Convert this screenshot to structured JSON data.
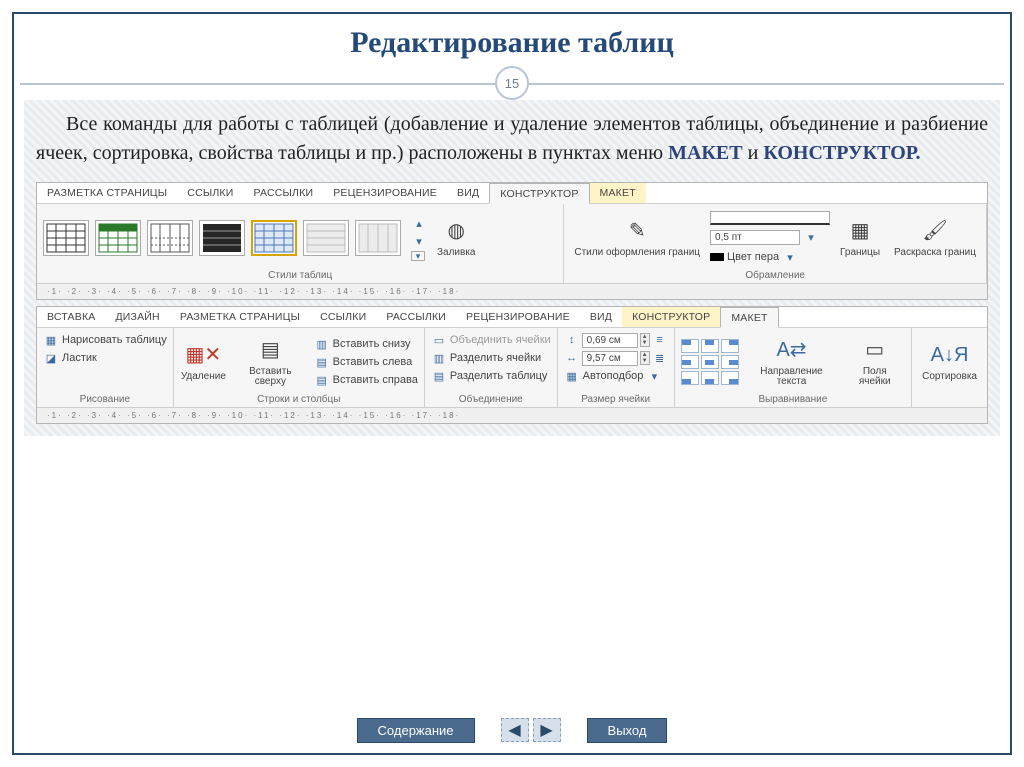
{
  "title": "Редактирование таблиц",
  "page_number": "15",
  "paragraph_pre": "Все команды для работы с таблицей (добавление и удаление элементов таблицы, объединение и разбиение ячеек,  сортировка,  свойства таблицы и пр.) расположены в пунктах меню ",
  "paragraph_b1": "МАКЕТ",
  "paragraph_mid": " и ",
  "paragraph_b2": "КОНСТРУКТОР.",
  "ribbon1": {
    "tabs": [
      "РАЗМЕТКА СТРАНИЦЫ",
      "ССЫЛКИ",
      "РАССЫЛКИ",
      "РЕЦЕНЗИРОВАНИЕ",
      "ВИД",
      "КОНСТРУКТОР",
      "МАКЕТ"
    ],
    "active_tab_index": 5,
    "group_styles_label": "Стили таблиц",
    "fill_label": "Заливка",
    "border_styles_label": "Стили оформления границ",
    "width_value": "0,5 пт",
    "pen_color_label": "Цвет пера",
    "group_border_label": "Обрамление",
    "borders_btn": "Границы",
    "paint_borders_btn": "Раскраска границ",
    "ruler_marks": "·1· ·2· ·3· ·4· ·5· ·6· ·7· ·8· ·9· ·10· ·11· ·12· ·13· ·14· ·15· ·16· ·17· ·18·"
  },
  "ribbon2": {
    "tabs": [
      "ВСТАВКА",
      "ДИЗАЙН",
      "РАЗМЕТКА СТРАНИЦЫ",
      "ССЫЛКИ",
      "РАССЫЛКИ",
      "РЕЦЕНЗИРОВАНИЕ",
      "ВИД",
      "КОНСТРУКТОР",
      "МАКЕТ"
    ],
    "active_tab_index": 8,
    "draw_table": "Нарисовать таблицу",
    "eraser": "Ластик",
    "group_draw": "Рисование",
    "delete": "Удаление",
    "insert_above": "Вставить сверху",
    "insert_below": "Вставить снизу",
    "insert_left": "Вставить слева",
    "insert_right": "Вставить справа",
    "group_rowscols": "Строки и столбцы",
    "merge": "Объединить ячейки",
    "split_cells": "Разделить ячейки",
    "split_table": "Разделить таблицу",
    "group_merge": "Объединение",
    "height_value": "0,69 см",
    "width_value": "9,57 см",
    "autofit": "Автоподбор",
    "group_size": "Размер ячейки",
    "text_dir": "Направление текста",
    "cell_margins": "Поля ячейки",
    "group_align": "Выравнивание",
    "sort": "Сортировка",
    "ruler_marks": "·1· ·2· ·3· ·4· ·5· ·6· ·7· ·8· ·9· ·10· ·11· ·12· ·13· ·14· ·15· ·16· ·17· ·18·"
  },
  "footer": {
    "contents": "Содержание",
    "exit": "Выход"
  }
}
